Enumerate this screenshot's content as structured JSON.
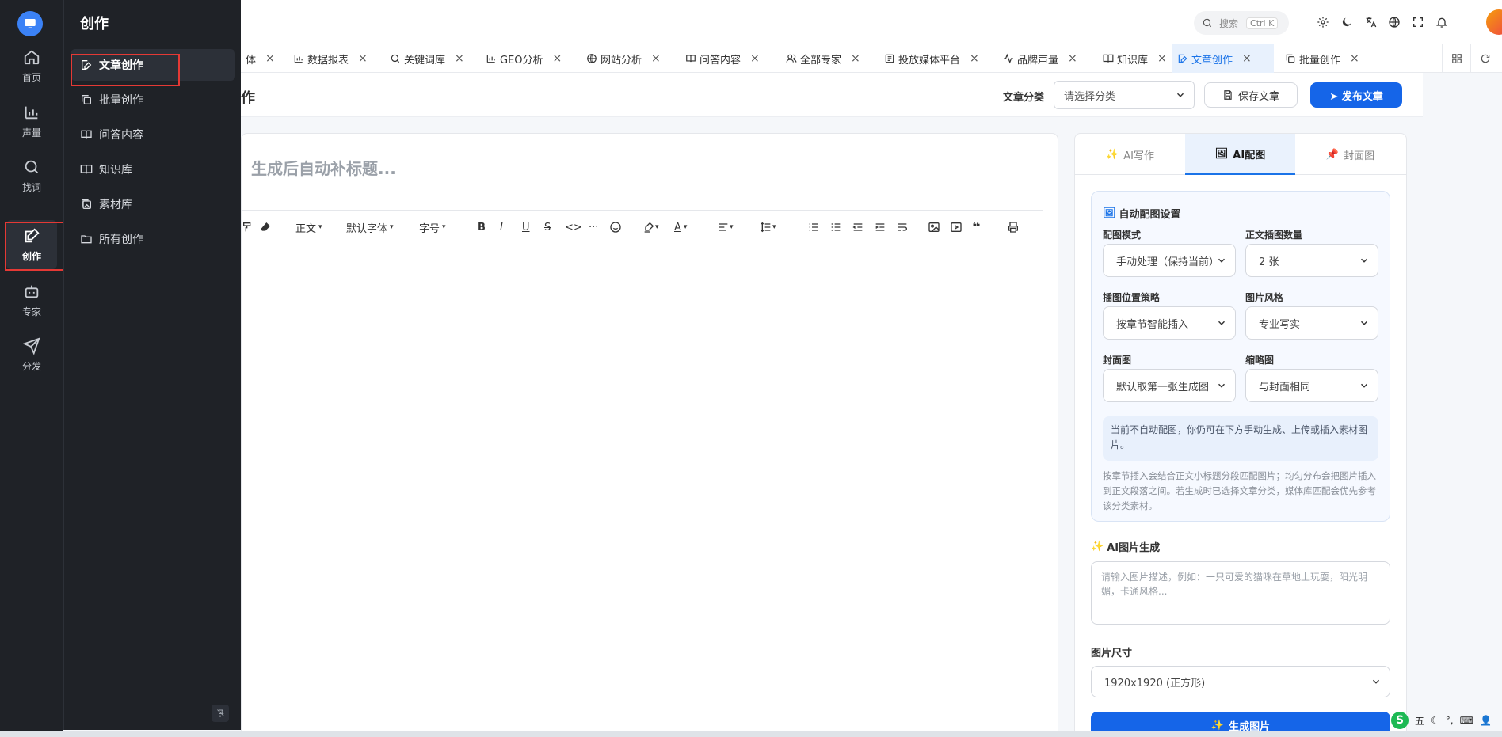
{
  "rail": {
    "items": [
      {
        "label": "首页",
        "icon": "home-icon"
      },
      {
        "label": "声量",
        "icon": "bar-chart-icon"
      },
      {
        "label": "找词",
        "icon": "search-icon"
      },
      {
        "label": "创作",
        "icon": "edit-icon",
        "active": true
      },
      {
        "label": "专家",
        "icon": "robot-icon"
      },
      {
        "label": "分发",
        "icon": "send-icon"
      }
    ]
  },
  "submenu": {
    "title": "创作",
    "items": [
      {
        "label": "文章创作",
        "icon": "edit-doc-icon",
        "active": true
      },
      {
        "label": "批量创作",
        "icon": "copy-icon"
      },
      {
        "label": "问答内容",
        "icon": "book-icon"
      },
      {
        "label": "知识库",
        "icon": "book-open-icon"
      },
      {
        "label": "素材库",
        "icon": "image-stack-icon"
      },
      {
        "label": "所有创作",
        "icon": "folder-icon"
      }
    ]
  },
  "header": {
    "search_placeholder": "搜索",
    "search_shortcut": "Ctrl K"
  },
  "tabs": [
    {
      "label": "体",
      "icon": "",
      "partial": true
    },
    {
      "label": "数据报表",
      "icon": "bar-chart-icon"
    },
    {
      "label": "关键词库",
      "icon": "search-icon"
    },
    {
      "label": "GEO分析",
      "icon": "bar-chart-icon"
    },
    {
      "label": "网站分析",
      "icon": "globe-icon"
    },
    {
      "label": "问答内容",
      "icon": "book-icon"
    },
    {
      "label": "全部专家",
      "icon": "users-icon"
    },
    {
      "label": "投放媒体平台",
      "icon": "newspaper-icon"
    },
    {
      "label": "品牌声量",
      "icon": "activity-icon"
    },
    {
      "label": "知识库",
      "icon": "book-open-icon"
    },
    {
      "label": "文章创作",
      "icon": "edit-doc-icon",
      "active": true
    },
    {
      "label": "批量创作",
      "icon": "copy-icon"
    }
  ],
  "page": {
    "title_partial": "作",
    "category_label": "文章分类",
    "category_placeholder": "请选择分类",
    "save_label": "保存文章",
    "publish_label": "➤ 发布文章"
  },
  "editor": {
    "title_placeholder": "生成后自动补标题...",
    "toolbar": {
      "paragraph": "正文",
      "font": "默认字体",
      "size": "字号"
    }
  },
  "rpanel": {
    "tabs": [
      {
        "label": "AI写作",
        "icon": "sparkle-icon"
      },
      {
        "label": "AI配图",
        "icon": "image-icon",
        "active": true
      },
      {
        "label": "封面图",
        "icon": "pin-icon"
      }
    ],
    "settings": {
      "title": "自动配图设置",
      "mode_label": "配图模式",
      "mode_value": "手动处理（保持当前）",
      "count_label": "正文插图数量",
      "count_value": "2 张",
      "position_label": "插图位置策略",
      "position_value": "按章节智能插入",
      "style_label": "图片风格",
      "style_value": "专业写实",
      "cover_label": "封面图",
      "cover_value": "默认取第一张生成图",
      "thumb_label": "缩略图",
      "thumb_value": "与封面相同",
      "info": "当前不自动配图，你仍可在下方手动生成、上传或插入素材图片。",
      "note": "按章节插入会结合正文小标题分段匹配图片；均匀分布会把图片插入到正文段落之间。若生成时已选择文章分类，媒体库匹配会优先参考该分类素材。"
    },
    "ai_gen_title": "AI图片生成",
    "prompt_placeholder": "请输入图片描述，例如：一只可爱的猫咪在草地上玩耍，阳光明媚，卡通风格...",
    "size_label": "图片尺寸",
    "size_value": "1920x1920 (正方形)",
    "gen_button": "生成图片"
  },
  "tray": {
    "ime": "S",
    "ime_mode": "五"
  },
  "colors": {
    "sidebar_bg": "#1f2227",
    "accent": "#1565e8",
    "highlight_box": "#e53935"
  }
}
